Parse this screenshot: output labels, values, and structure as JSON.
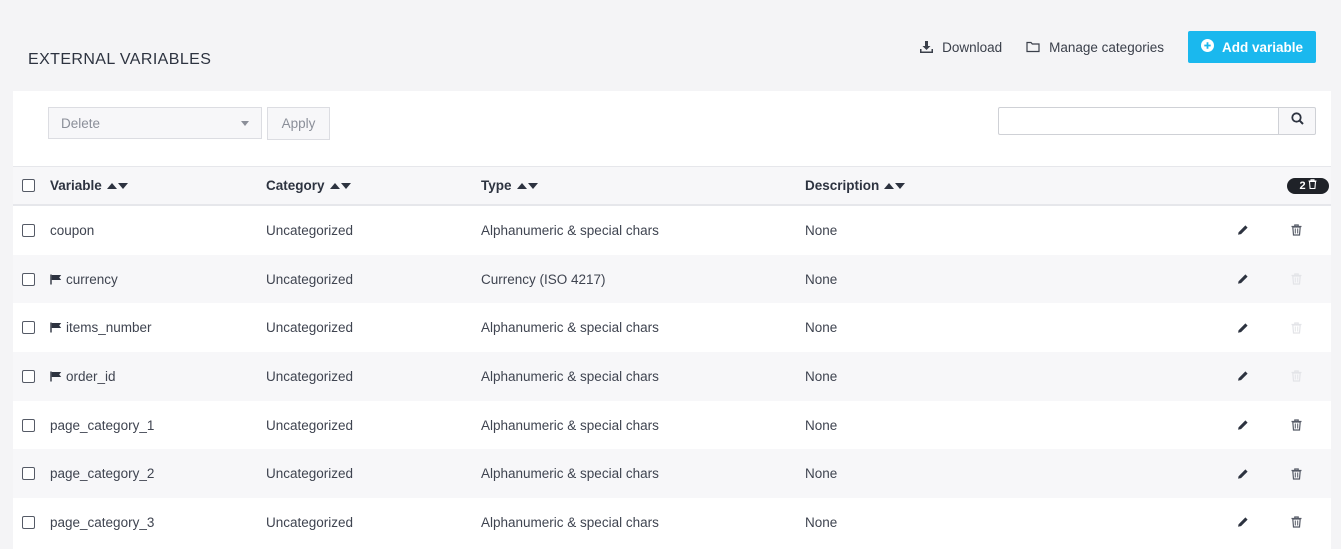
{
  "page": {
    "title": "EXTERNAL VARIABLES"
  },
  "top_actions": {
    "download_label": "Download",
    "manage_label": "Manage categories",
    "add_label": "Add variable",
    "add_color": "#1ab8ee"
  },
  "bulk": {
    "selected": "Delete",
    "apply_label": "Apply"
  },
  "search": {
    "placeholder": "",
    "value": ""
  },
  "table": {
    "headers": {
      "variable": "Variable",
      "category": "Category",
      "type": "Type",
      "description": "Description"
    },
    "delete_count": "2",
    "rows": [
      {
        "variable": "coupon",
        "flag": false,
        "category": "Uncategorized",
        "type": "Alphanumeric & special chars",
        "description": "None",
        "delete_enabled": true
      },
      {
        "variable": "currency",
        "flag": true,
        "category": "Uncategorized",
        "type": "Currency (ISO 4217)",
        "description": "None",
        "delete_enabled": false
      },
      {
        "variable": "items_number",
        "flag": true,
        "category": "Uncategorized",
        "type": "Alphanumeric & special chars",
        "description": "None",
        "delete_enabled": false
      },
      {
        "variable": "order_id",
        "flag": true,
        "category": "Uncategorized",
        "type": "Alphanumeric & special chars",
        "description": "None",
        "delete_enabled": false
      },
      {
        "variable": "page_category_1",
        "flag": false,
        "category": "Uncategorized",
        "type": "Alphanumeric & special chars",
        "description": "None",
        "delete_enabled": true
      },
      {
        "variable": "page_category_2",
        "flag": false,
        "category": "Uncategorized",
        "type": "Alphanumeric & special chars",
        "description": "None",
        "delete_enabled": true
      },
      {
        "variable": "page_category_3",
        "flag": false,
        "category": "Uncategorized",
        "type": "Alphanumeric & special chars",
        "description": "None",
        "delete_enabled": true
      }
    ]
  },
  "icons": {
    "download": "download-icon",
    "manage": "folder-icon",
    "add": "plus-circle-icon",
    "search": "search-icon",
    "edit": "pencil-icon",
    "delete": "trash-icon",
    "flag": "flag-icon"
  }
}
